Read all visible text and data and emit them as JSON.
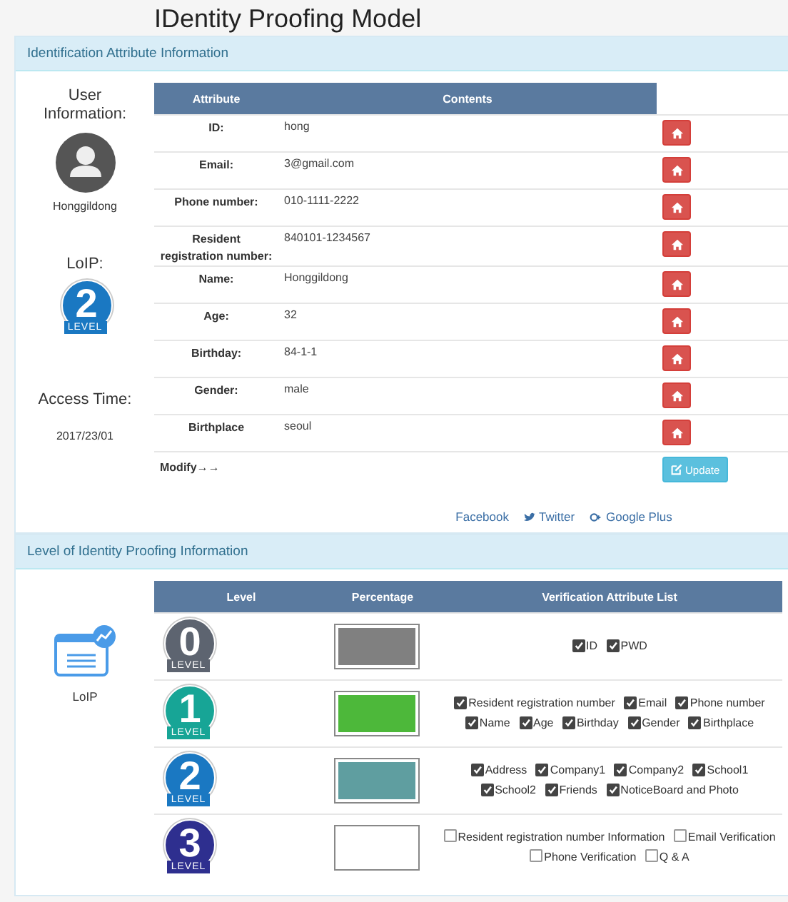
{
  "title": "IDentity Proofing Model",
  "identification": {
    "heading": "Identification Attribute Information",
    "user_label": "User Information:",
    "user_name": "Honggildong",
    "loip_label": "LoIP:",
    "loip_badge": {
      "number": "2",
      "label": "LEVEL",
      "color": "#1a78c2"
    },
    "access_label": "Access Time:",
    "access_time": "2017/23/01",
    "columns": [
      "Attribute",
      "Contents"
    ],
    "rows": [
      {
        "attribute": "ID:",
        "value": "hong"
      },
      {
        "attribute": "Email:",
        "value": "3@gmail.com"
      },
      {
        "attribute": "Phone number:",
        "value": "010-1111-2222"
      },
      {
        "attribute": "Resident registration number:",
        "value": "840101-1234567"
      },
      {
        "attribute": "Name:",
        "value": "Honggildong"
      },
      {
        "attribute": "Age:",
        "value": "32"
      },
      {
        "attribute": "Birthday:",
        "value": "84-1-1"
      },
      {
        "attribute": "Gender:",
        "value": "male"
      },
      {
        "attribute": "Birthplace",
        "value": "seoul"
      }
    ],
    "modify_label": "Modify→→",
    "update_button": "Update",
    "social_links": [
      {
        "kind": "plain",
        "label": "Facebook"
      },
      {
        "kind": "twitter",
        "label": "Twitter"
      },
      {
        "kind": "plus",
        "label": "Google Plus"
      }
    ]
  },
  "levels": {
    "heading": "Level of Identity Proofing Information",
    "icon_label": "LoIP",
    "columns": [
      "Level",
      "Percentage",
      "Verification Attribute List"
    ],
    "rows": [
      {
        "badge": {
          "number": "0",
          "label": "LEVEL",
          "color": "#5d6470"
        },
        "color": "#808080",
        "attributes": [
          {
            "label": "ID",
            "checked": true
          },
          {
            "label": "PWD",
            "checked": true
          }
        ]
      },
      {
        "badge": {
          "number": "1",
          "label": "LEVEL",
          "color": "#17a596"
        },
        "color": "#4db83a",
        "attributes": [
          {
            "label": "Resident registration number",
            "checked": true
          },
          {
            "label": "Email",
            "checked": true
          },
          {
            "label": "Phone number",
            "checked": true
          },
          {
            "label": "Name",
            "checked": true
          },
          {
            "label": "Age",
            "checked": true
          },
          {
            "label": "Birthday",
            "checked": true
          },
          {
            "label": "Gender",
            "checked": true
          },
          {
            "label": "Birthplace",
            "checked": true
          }
        ]
      },
      {
        "badge": {
          "number": "2",
          "label": "LEVEL",
          "color": "#1a78c2"
        },
        "color": "#5f9ea0",
        "attributes": [
          {
            "label": "Address",
            "checked": true
          },
          {
            "label": "Company1",
            "checked": true
          },
          {
            "label": "Company2",
            "checked": true
          },
          {
            "label": "School1",
            "checked": true
          },
          {
            "label": "School2",
            "checked": true
          },
          {
            "label": "Friends",
            "checked": true
          },
          {
            "label": "NoticeBoard and Photo",
            "checked": true
          }
        ]
      },
      {
        "badge": {
          "number": "3",
          "label": "LEVEL",
          "color": "#2e2f8f"
        },
        "color": "#ffffff",
        "attributes": [
          {
            "label": "Resident registration number Information",
            "checked": false
          },
          {
            "label": "Email Verification",
            "checked": false
          },
          {
            "label": "Phone Verification",
            "checked": false
          },
          {
            "label": "Q & A",
            "checked": false
          }
        ]
      }
    ]
  }
}
